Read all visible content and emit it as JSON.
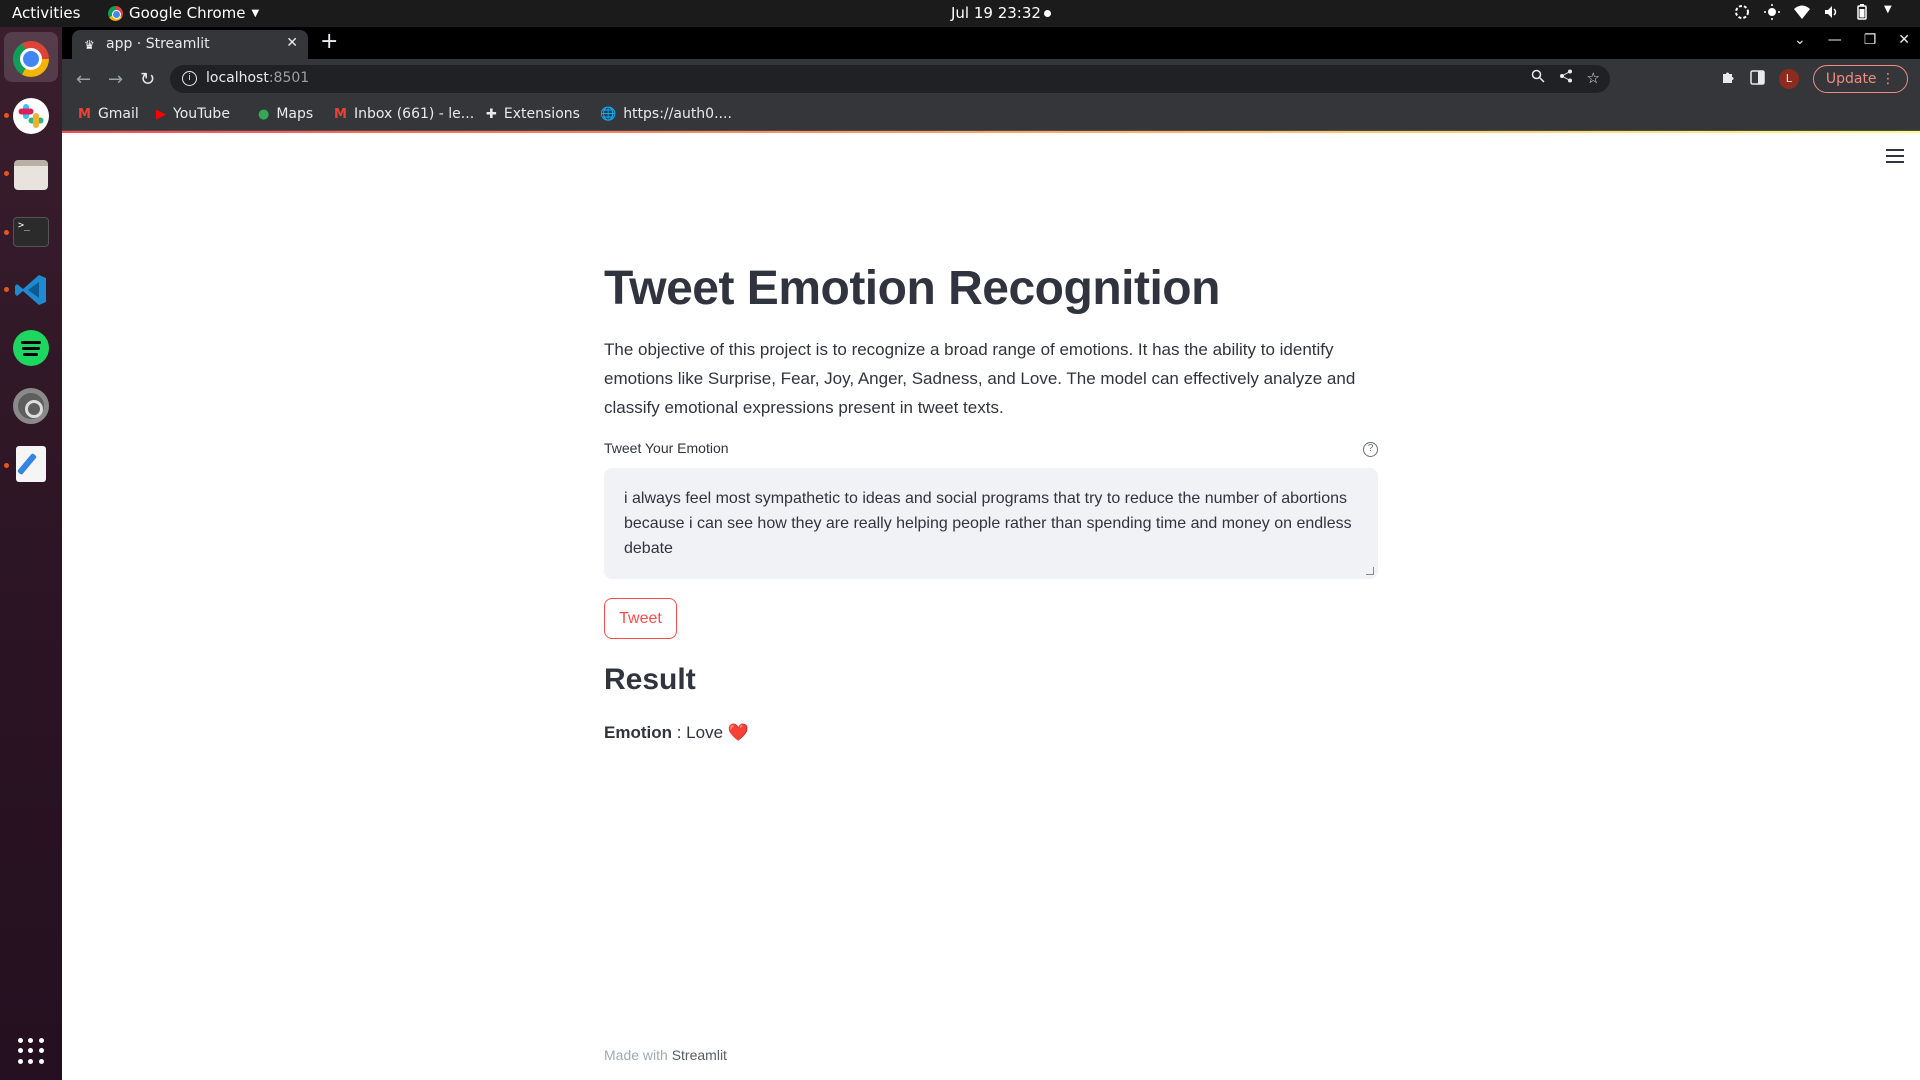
{
  "system_bar": {
    "activities": "Activities",
    "app_name": "Google Chrome",
    "clock": "Jul 19  23:32"
  },
  "browser": {
    "tab_title": "app · Streamlit",
    "url_host": "localhost",
    "url_port": ":8501",
    "update_label": "Update",
    "profile_initial": "L",
    "bookmarks": [
      "Gmail",
      "YouTube",
      "Maps",
      "Inbox (661) - le...",
      "Extensions",
      "https://auth0...."
    ]
  },
  "app": {
    "title": "Tweet Emotion Recognition",
    "description": "The objective of this project is to recognize a broad range of emotions. It has the ability to identify emotions like Surprise, Fear, Joy, Anger, Sadness, and Love. The model can effectively analyze and classify emotional expressions present in tweet texts.",
    "input_label": "Tweet Your Emotion",
    "input_value": "i always feel most sympathetic to ideas and social programs that try to reduce the number of abortions because i can see how they are really helping people rather than spending time and money on endless debate",
    "button_label": "Tweet",
    "result_heading": "Result",
    "result_key": "Emotion",
    "result_sep": " : ",
    "result_value": "Love",
    "result_emoji": "❤️",
    "footer_prefix": "Made with ",
    "footer_brand": "Streamlit"
  },
  "colors": {
    "accent": "#ff4b4b",
    "text": "#31333f",
    "input_bg": "#f0f2f6"
  }
}
